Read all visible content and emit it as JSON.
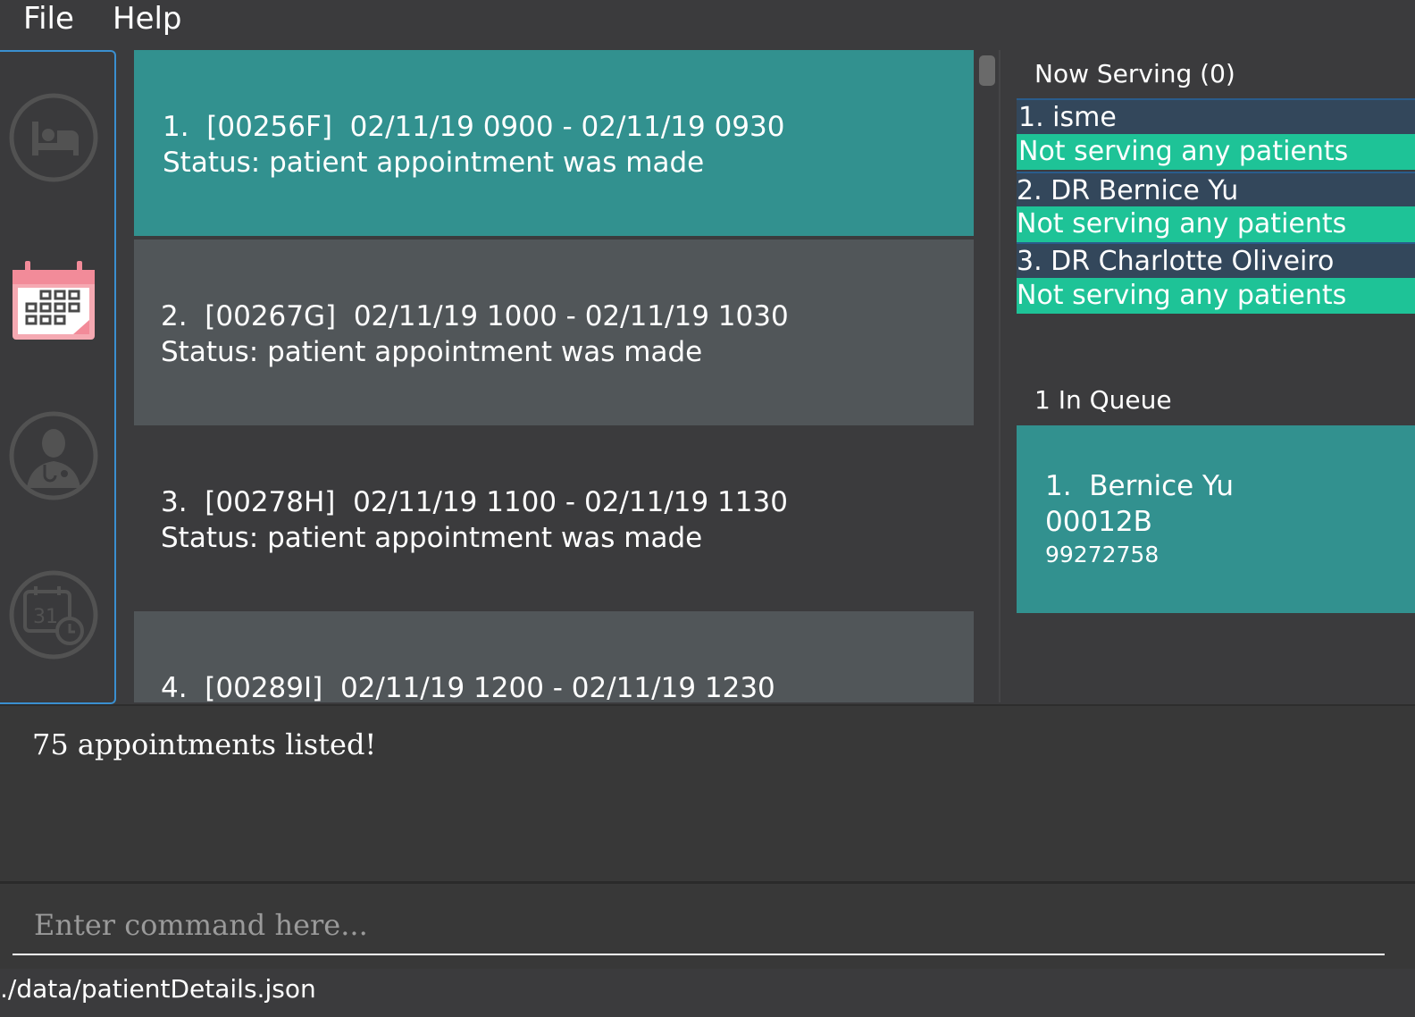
{
  "menu": {
    "file": "File",
    "help": "Help"
  },
  "sidebar": {
    "items": [
      {
        "icon": "bed-icon",
        "active": false
      },
      {
        "icon": "calendar-icon",
        "active": true
      },
      {
        "icon": "doctor-icon",
        "active": false
      },
      {
        "icon": "calendar-clock-icon",
        "active": false
      }
    ]
  },
  "appointments": [
    {
      "line1": "1.  [00256F]  02/11/19 0900 - 02/11/19 0930",
      "line2": "Status: patient appointment was made",
      "bg": "#32918f"
    },
    {
      "line1": "2.  [00267G]  02/11/19 1000 - 02/11/19 1030",
      "line2": "Status: patient appointment was made",
      "bg": "#515659"
    },
    {
      "line1": "3.  [00278H]  02/11/19 1100 - 02/11/19 1130",
      "line2": "Status: patient appointment was made",
      "bg": "#3b3b3d"
    },
    {
      "line1": "4.  [00289I]  02/11/19 1200 - 02/11/19 1230",
      "line2": "",
      "bg": "#515659"
    }
  ],
  "now_serving": {
    "title": "Now Serving (0)",
    "doctors": [
      {
        "name": "1. isme",
        "status": "Not serving any patients"
      },
      {
        "name": "2. DR Bernice Yu",
        "status": "Not serving any patients"
      },
      {
        "name": "3. DR Charlotte Oliveiro",
        "status": "Not serving any patients"
      }
    ]
  },
  "queue": {
    "title": "1 In Queue",
    "items": [
      {
        "name": "1.  Bernice Yu",
        "id": "00012B",
        "phone": "99272758"
      }
    ]
  },
  "result": {
    "text": "75 appointments listed!"
  },
  "command": {
    "placeholder": "Enter command here...",
    "value": ""
  },
  "status": {
    "path": "./data/patientDetails.json"
  },
  "colors": {
    "accent_teal": "#32918f",
    "serving_green": "#1ec397",
    "doctor_row": "#33475b",
    "sidebar_border": "#3a8fd0"
  }
}
